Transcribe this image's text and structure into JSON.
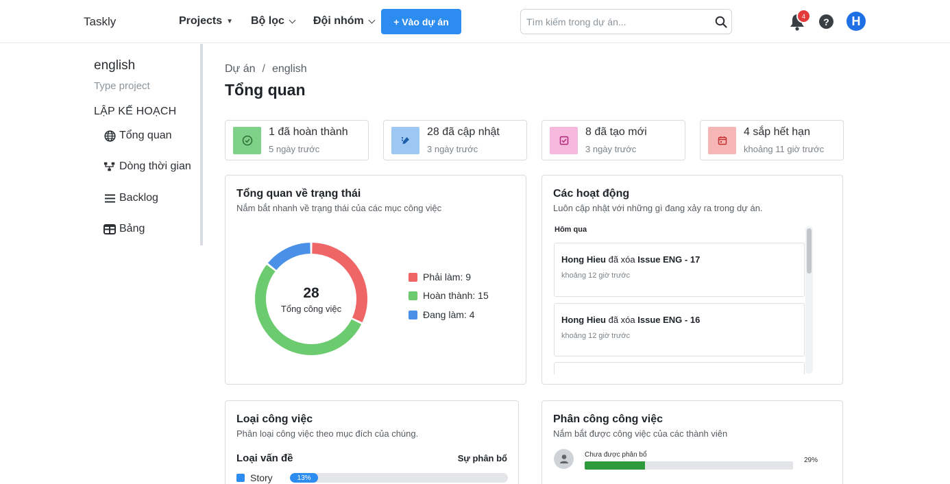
{
  "header": {
    "brand": "Taskly",
    "nav": [
      {
        "label": "Projects",
        "caret": "▼"
      },
      {
        "label": "Bộ lọc"
      },
      {
        "label": "Đội nhóm"
      }
    ],
    "primary_button": "+ Vào dự án",
    "search_placeholder": "Tìm kiếm trong dự án...",
    "notification_count": "4",
    "help_label": "?",
    "avatar_initial": "H"
  },
  "sidebar": {
    "project_name": "english",
    "project_type": "Type project",
    "section_title": "LẬP KẾ HOẠCH",
    "items": [
      {
        "label": "Tổng quan",
        "icon": "globe-icon"
      },
      {
        "label": "Dòng thời gian",
        "icon": "timeline-icon"
      },
      {
        "label": "Backlog",
        "icon": "list-icon"
      },
      {
        "label": "Bảng",
        "icon": "board-icon"
      }
    ]
  },
  "main": {
    "breadcrumb": {
      "root": "Dự án",
      "separator": "/",
      "current": "english"
    },
    "title": "Tổng quan",
    "stats": [
      {
        "label": "1 đã hoàn thành",
        "time": "5 ngày trước",
        "icon": "check-circle-icon",
        "bg": "#7fd18a",
        "fg": "#2b6d33"
      },
      {
        "label": "28 đã cập nhật",
        "time": "3 ngày trước",
        "icon": "edit-icon",
        "bg": "#9cc8f3",
        "fg": "#1f5ea8"
      },
      {
        "label": "8 đã tạo mới",
        "time": "3 ngày trước",
        "icon": "check-square-icon",
        "bg": "#f6b8dc",
        "fg": "#b0287a"
      },
      {
        "label": "4 sắp hết hạn",
        "time": "khoảng 11 giờ trước",
        "icon": "calendar-icon",
        "bg": "#f7b6b6",
        "fg": "#c22f2f"
      }
    ],
    "status_panel": {
      "title": "Tổng quan về trạng thái",
      "subtitle": "Nắm bắt nhanh về trạng thái của các mục công việc",
      "total": "28",
      "total_label": "Tổng công việc",
      "legend": [
        "Phải làm: 9",
        "Hoàn thành: 15",
        "Đang làm: 4"
      ]
    },
    "activity_panel": {
      "title": "Các hoạt động",
      "subtitle": "Luôn cập nhật với những gì đang xảy ra trong dự án.",
      "day": "Hôm qua",
      "items": [
        {
          "user": "Hong Hieu",
          "action": " đã xóa ",
          "target": "Issue ENG - 17",
          "time": "khoảng 12 giờ trước"
        },
        {
          "user": "Hong Hieu",
          "action": " đã xóa ",
          "target": "Issue ENG - 16",
          "time": "khoảng 12 giờ trước"
        }
      ]
    },
    "type_panel": {
      "title": "Loại công việc",
      "subtitle": "Phân loại công việc theo mục đích của chúng.",
      "col_type": "Loại vấn đề",
      "col_dist": "Sự phân bổ",
      "rows": [
        {
          "label": "Story",
          "percent_label": "13%",
          "fraction": 0.13
        }
      ]
    },
    "assign_panel": {
      "title": "Phân công công việc",
      "subtitle": "Nắm bắt được công việc của các thành viên",
      "rows": [
        {
          "name": "Chưa được phân bổ",
          "percent_label": "29%",
          "fraction": 0.29
        }
      ]
    }
  },
  "chart_data": {
    "type": "pie",
    "categories": [
      "Phải làm",
      "Hoàn thành",
      "Đang làm"
    ],
    "values": [
      9,
      15,
      4
    ],
    "colors": [
      "#f06565",
      "#6ccb6f",
      "#4a90e8"
    ],
    "total": 28,
    "title": "Tổng quan về trạng thái"
  },
  "colors": {
    "primary": "#2d8cf0",
    "todo": "#f06565",
    "done": "#6ccb6f",
    "in_progress": "#4a90e8",
    "assign_bar": "#2e9a3c",
    "badge": "#e33a3a"
  }
}
